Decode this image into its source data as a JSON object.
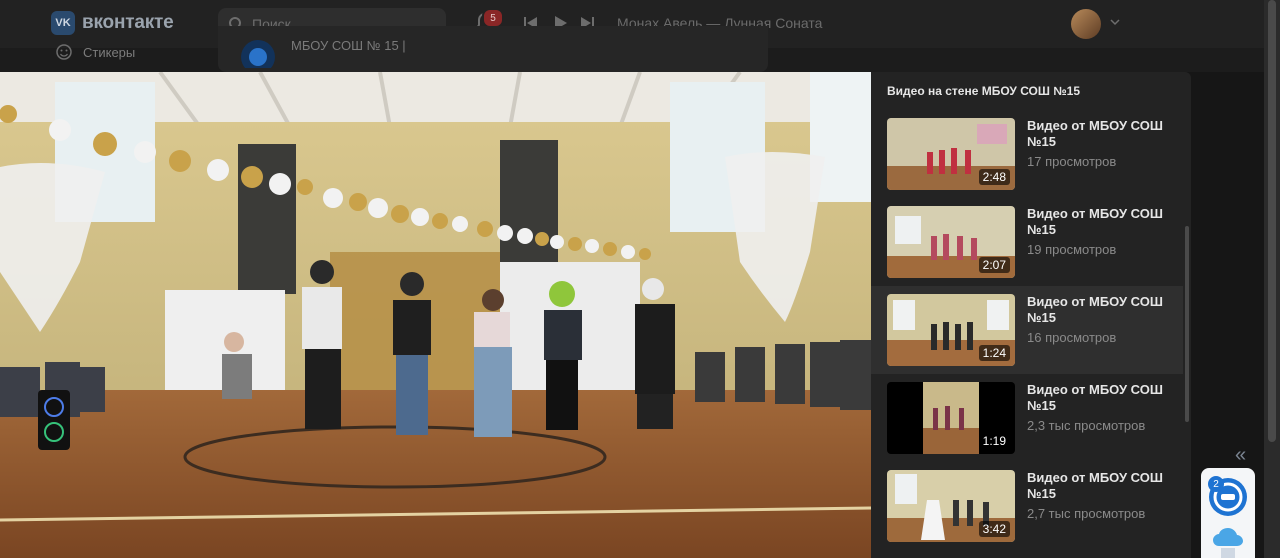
{
  "header": {
    "brand": "вконтакте",
    "brand_logo": "VK",
    "search_placeholder": "Поиск",
    "notifications_count": "5",
    "now_playing": "Монах Авель — Лунная Соната"
  },
  "background": {
    "stickers_label": "Стикеры",
    "post_author": "МБОУ СОШ № 15 |"
  },
  "sidebar": {
    "title": "Видео на стене МБОУ СОШ №15",
    "collapse_label": "«",
    "videos": [
      {
        "title": "Видео от МБОУ СОШ №15",
        "views": "17 просмотров",
        "duration": "2:48"
      },
      {
        "title": "Видео от МБОУ СОШ №15",
        "views": "19 просмотров",
        "duration": "2:07"
      },
      {
        "title": "Видео от МБОУ СОШ №15",
        "views": "16 просмотров",
        "duration": "1:24"
      },
      {
        "title": "Видео от МБОУ СОШ №15",
        "views": "2,3 тыс просмотров",
        "duration": "1:19"
      },
      {
        "title": "Видео от МБОУ СОШ №15",
        "views": "2,7 тыс просмотров",
        "duration": "3:42"
      }
    ]
  },
  "widget": {
    "badge": "2"
  },
  "colors": {
    "accent": "#1e73d2",
    "badge": "#8a2626",
    "panel": "#232323"
  }
}
